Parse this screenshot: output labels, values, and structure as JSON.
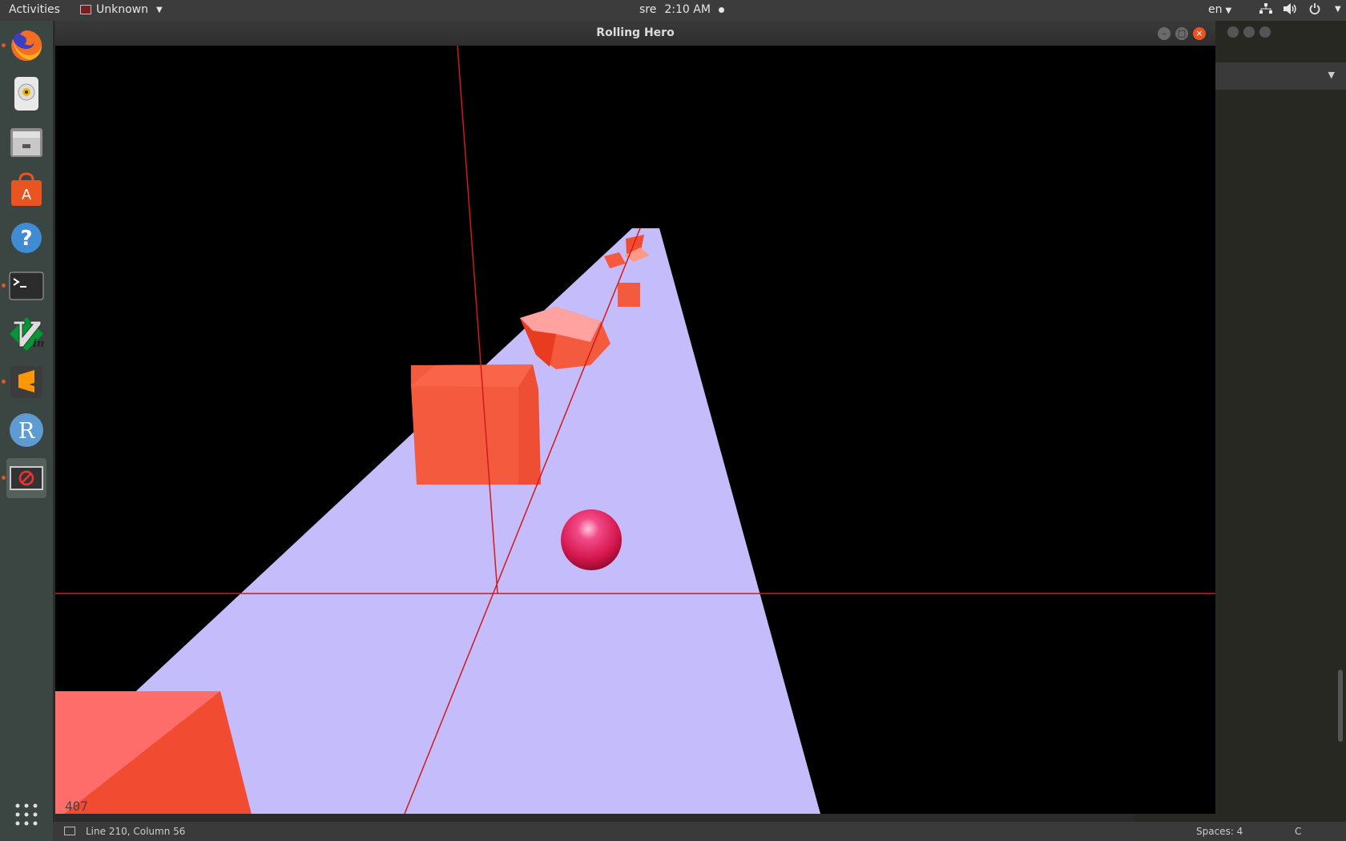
{
  "topbar": {
    "activities": "Activities",
    "app_name": "Unknown",
    "clock_user": "sre",
    "clock_time": "2:10 AM",
    "language": "en",
    "icons": [
      "network-icon",
      "volume-icon",
      "power-icon"
    ]
  },
  "dock": {
    "items": [
      {
        "name": "firefox-icon",
        "running": true
      },
      {
        "name": "rhythmbox-icon",
        "running": false
      },
      {
        "name": "files-icon",
        "running": false
      },
      {
        "name": "software-center-icon",
        "running": false
      },
      {
        "name": "help-icon",
        "running": false
      },
      {
        "name": "terminal-icon",
        "running": true
      },
      {
        "name": "vim-icon",
        "running": false
      },
      {
        "name": "sublime-text-icon",
        "running": true
      },
      {
        "name": "r-icon",
        "running": false
      },
      {
        "name": "game-app-icon",
        "running": true
      }
    ],
    "show_apps": "apps-grid-icon"
  },
  "window": {
    "title": "Rolling Hero",
    "counter": "407"
  },
  "scene": {
    "background": "#000000",
    "path_color": "#c5bcfb",
    "obstacle_color": "#f35a3e",
    "ball_color": "#e6256b",
    "axis_color": "#d11a1a"
  },
  "statusbar": {
    "position": "Line 210, Column 56",
    "spaces": "Spaces: 4",
    "syntax": "C"
  }
}
